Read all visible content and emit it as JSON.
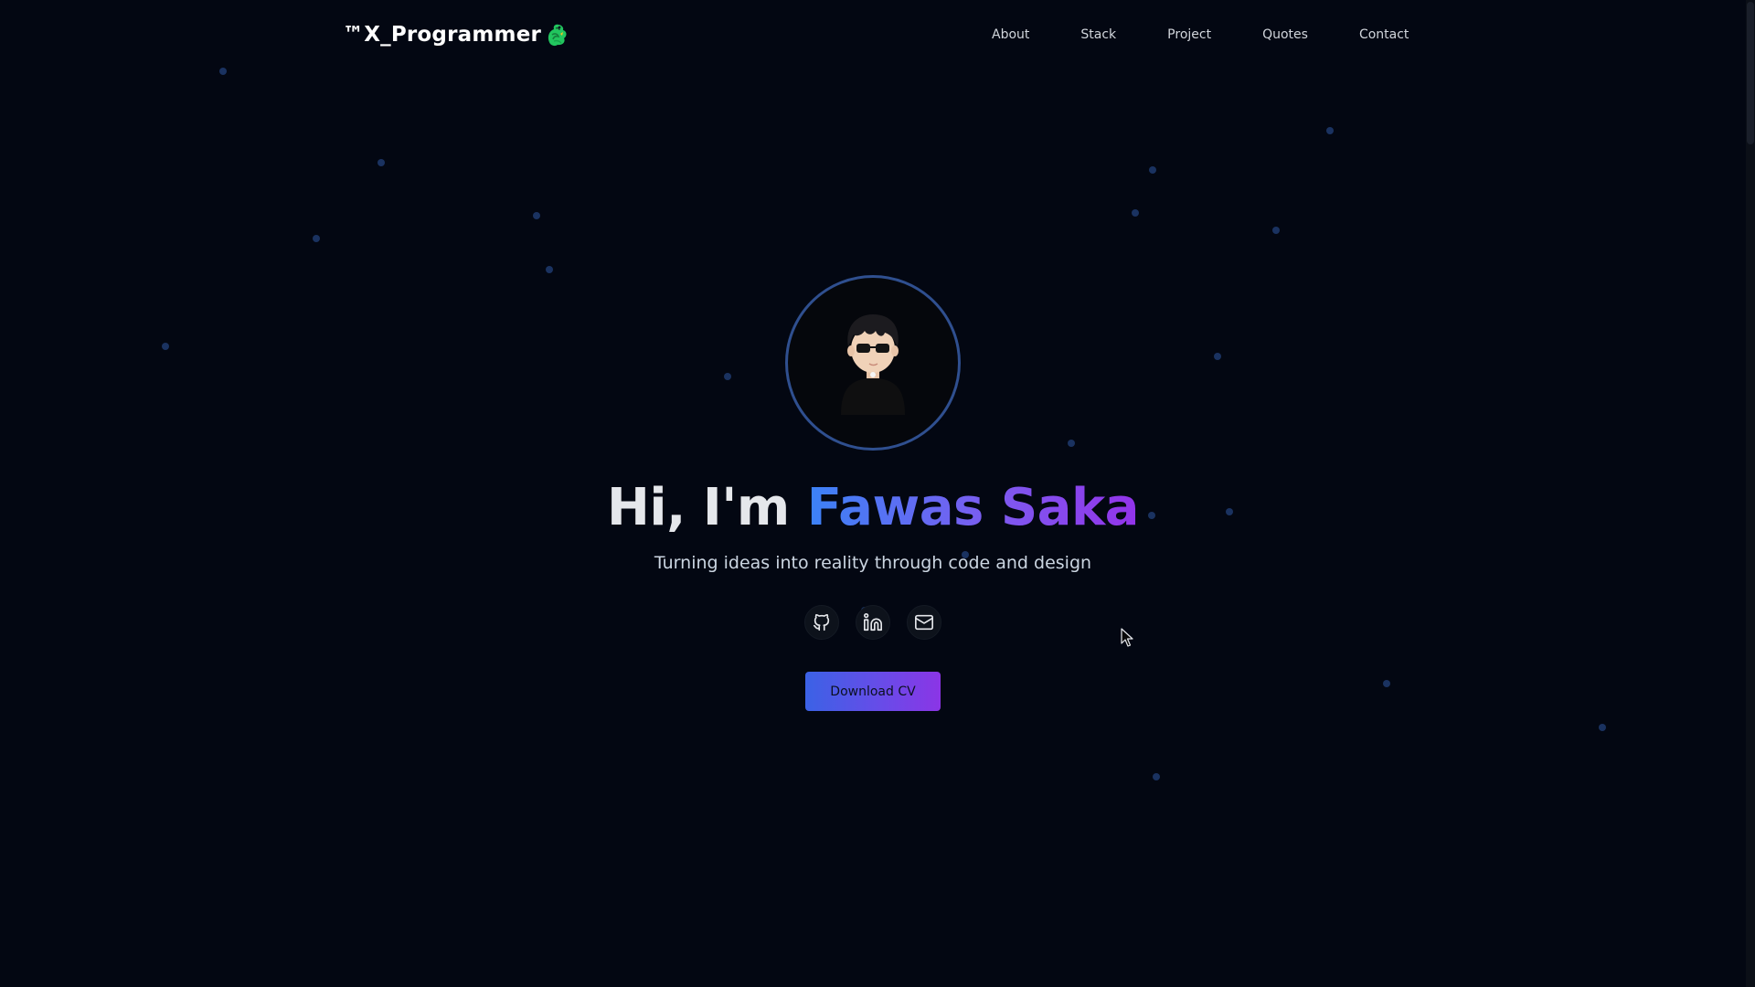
{
  "brand": {
    "name": "™X_Programmer",
    "icon": "dragon-icon"
  },
  "nav": {
    "items": [
      {
        "label": "About"
      },
      {
        "label": "Stack"
      },
      {
        "label": "Project"
      },
      {
        "label": "Quotes"
      },
      {
        "label": "Contact"
      }
    ]
  },
  "hero": {
    "greeting": "Hi, I'm ",
    "name": "Fawas Saka",
    "subtitle": "Turning ideas into reality through code and design",
    "avatar_icon": "avatar-illustration"
  },
  "socials": [
    {
      "icon": "github-icon"
    },
    {
      "icon": "linkedin-icon"
    },
    {
      "icon": "mail-icon"
    }
  ],
  "cta": {
    "download_label": "Download CV"
  },
  "colors": {
    "background": "#030712",
    "gradient_start": "#3b82f6",
    "gradient_end": "#9333ea",
    "particle": "#1e3a6e",
    "avatar_ring": "#2f4f8f"
  }
}
